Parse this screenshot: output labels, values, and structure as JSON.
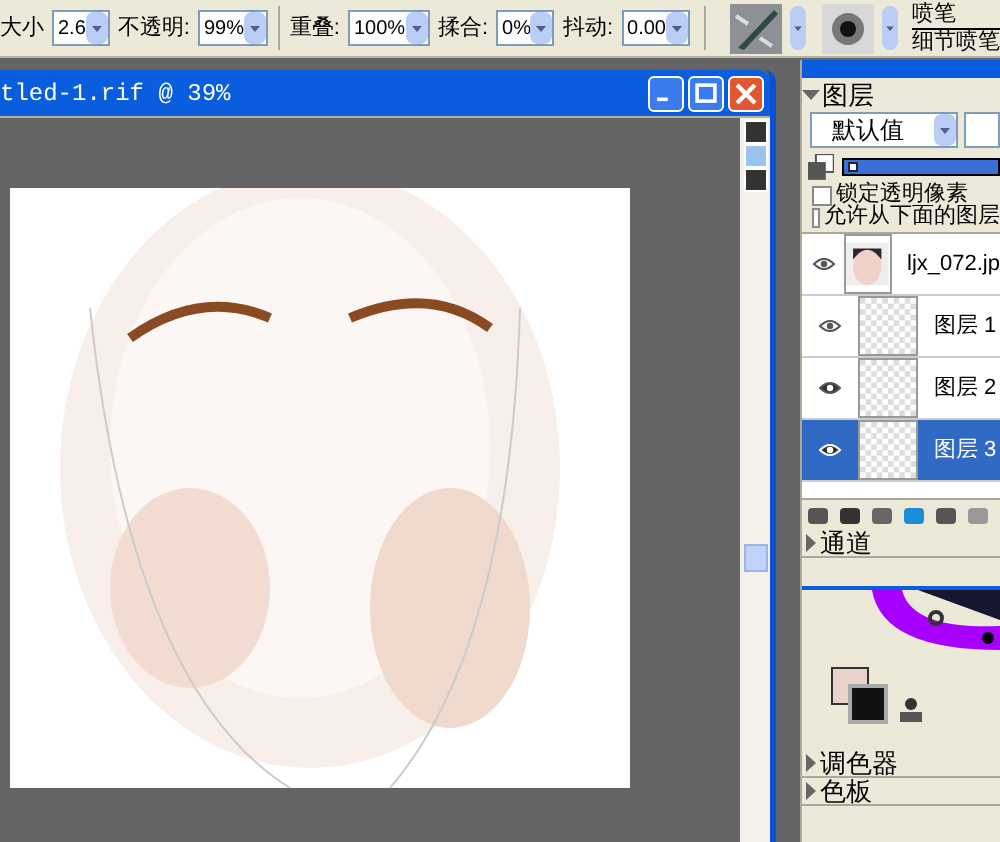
{
  "toolbar": {
    "fields": [
      {
        "label": "大小",
        "value": "2.6"
      },
      {
        "label": "不透明:",
        "value": "99%"
      },
      {
        "label": "重叠:",
        "value": "100%"
      },
      {
        "label": "揉合:",
        "value": "0%"
      },
      {
        "label": "抖动:",
        "value": "0.00"
      }
    ],
    "brush_category": "喷笔",
    "brush_variant": "细节喷笔"
  },
  "document": {
    "title": "tled-1.rif @ 39%"
  },
  "layers_panel": {
    "title": "图层",
    "composite": "默认值",
    "opacity": {
      "level": 1
    },
    "options": [
      {
        "label": "锁定透明像素",
        "checked": false
      },
      {
        "label": "允许从下面的图层",
        "checked": false
      }
    ],
    "layers": [
      {
        "name": "ljx_072.jp",
        "visible": false,
        "selected": false
      },
      {
        "name": "图层 1",
        "kind": "layer",
        "visible": false,
        "selected": false
      },
      {
        "name": "图层 2",
        "kind": "layer",
        "visible": true,
        "selected": false
      },
      {
        "name": "图层 3",
        "kind": "layer",
        "visible": true,
        "selected": true
      }
    ]
  },
  "sections": [
    {
      "title": "通道",
      "expanded": false
    },
    {
      "title": "调色器",
      "expanded": false
    },
    {
      "title": "色板",
      "expanded": false
    }
  ]
}
